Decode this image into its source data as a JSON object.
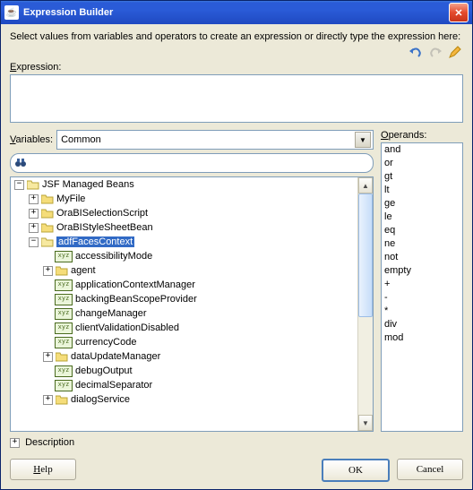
{
  "window": {
    "title": "Expression Builder"
  },
  "intro": "Select values from variables and operators to create an expression or directly type the expression here:",
  "labels": {
    "expression": "Expression:",
    "variables": "Variables:",
    "operands": "Operands:",
    "description": "Description"
  },
  "expression_value": "",
  "variables_select": {
    "selected": "Common"
  },
  "search": {
    "value": "",
    "placeholder": ""
  },
  "tree": {
    "root": {
      "label": "JSF Managed Beans",
      "children": [
        {
          "type": "folder",
          "label": "MyFile",
          "expandable": true
        },
        {
          "type": "folder",
          "label": "OraBISelectionScript",
          "expandable": true
        },
        {
          "type": "folder",
          "label": "OraBIStyleSheetBean",
          "expandable": true
        },
        {
          "type": "folder",
          "label": "adfFacesContext",
          "expandable": true,
          "expanded": true,
          "selected": true,
          "children": [
            {
              "type": "var",
              "label": "accessibilityMode"
            },
            {
              "type": "folder",
              "label": "agent",
              "expandable": true
            },
            {
              "type": "var",
              "label": "applicationContextManager"
            },
            {
              "type": "var",
              "label": "backingBeanScopeProvider"
            },
            {
              "type": "var",
              "label": "changeManager"
            },
            {
              "type": "var",
              "label": "clientValidationDisabled"
            },
            {
              "type": "var",
              "label": "currencyCode"
            },
            {
              "type": "folder",
              "label": "dataUpdateManager",
              "expandable": true
            },
            {
              "type": "var",
              "label": "debugOutput"
            },
            {
              "type": "var",
              "label": "decimalSeparator"
            },
            {
              "type": "folder",
              "label": "dialogService",
              "expandable": true
            }
          ]
        }
      ]
    }
  },
  "operands": [
    "and",
    "or",
    "gt",
    "lt",
    "ge",
    "le",
    "eq",
    "ne",
    "not",
    "empty",
    "+",
    "-",
    "*",
    "div",
    "mod"
  ],
  "buttons": {
    "help": "Help",
    "ok": "OK",
    "cancel": "Cancel"
  }
}
